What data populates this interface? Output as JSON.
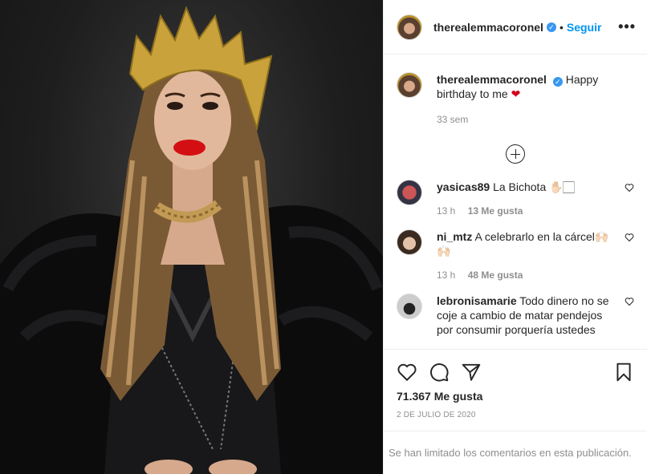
{
  "post": {
    "username": "therealemmacoronel",
    "follow_label": "Seguir",
    "separator": "•",
    "more_label": "•••",
    "caption_text": "Happy birthday to me",
    "caption_emoji": "❤",
    "caption_time": "33 sem"
  },
  "comments": [
    {
      "username": "yasicas89",
      "text": "La Bichota ✋🏻🏻",
      "time": "13 h",
      "likes": "13 Me gusta"
    },
    {
      "username": "ni_mtz",
      "text": "A celebrarlo en la cárcel🙌🏻🙌🏻",
      "time": "13 h",
      "likes": "48 Me gusta"
    },
    {
      "username": "lebronisamarie",
      "text": "Todo dinero no se coje a cambio de matar pendejos por consumir porquería ustedes"
    }
  ],
  "footer": {
    "likes": "71.367 Me gusta",
    "date": "2 DE JULIO DE 2020",
    "limited_text": "Se han limitado los comentarios en esta publicación."
  },
  "colors": {
    "accent": "#0095f6",
    "verified": "#3897f0",
    "heart": "#d0021b"
  }
}
